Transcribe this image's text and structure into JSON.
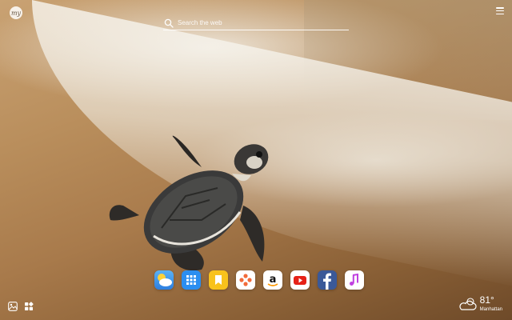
{
  "header": {
    "logo_text": "my",
    "menu_icon": "hamburger-menu-icon"
  },
  "search": {
    "placeholder": "Search the web",
    "icon": "search-icon"
  },
  "dock": {
    "apps": [
      {
        "name": "weather-app",
        "icon": "weather-sun-cloud-icon",
        "color": "#4aa3f0"
      },
      {
        "name": "apps-grid",
        "icon": "grid-icon",
        "color": "#2b8ef0"
      },
      {
        "name": "bookmarks",
        "icon": "bookmark-icon",
        "color": "#f8c21c"
      },
      {
        "name": "games",
        "icon": "game-controller-icon",
        "color": "#f26b3a"
      },
      {
        "name": "amazon",
        "icon": "amazon-icon",
        "color": "#ffffff"
      },
      {
        "name": "youtube",
        "icon": "youtube-icon",
        "color": "#e62117"
      },
      {
        "name": "facebook",
        "icon": "facebook-icon",
        "color": "#3b5998"
      },
      {
        "name": "music",
        "icon": "music-note-icon",
        "color": "#c040e0"
      }
    ]
  },
  "bottom_left": {
    "icons": [
      "photo-background-icon",
      "widgets-icon"
    ]
  },
  "weather": {
    "temperature": "81°",
    "location": "Manhattan",
    "icon": "partly-cloudy-icon"
  }
}
